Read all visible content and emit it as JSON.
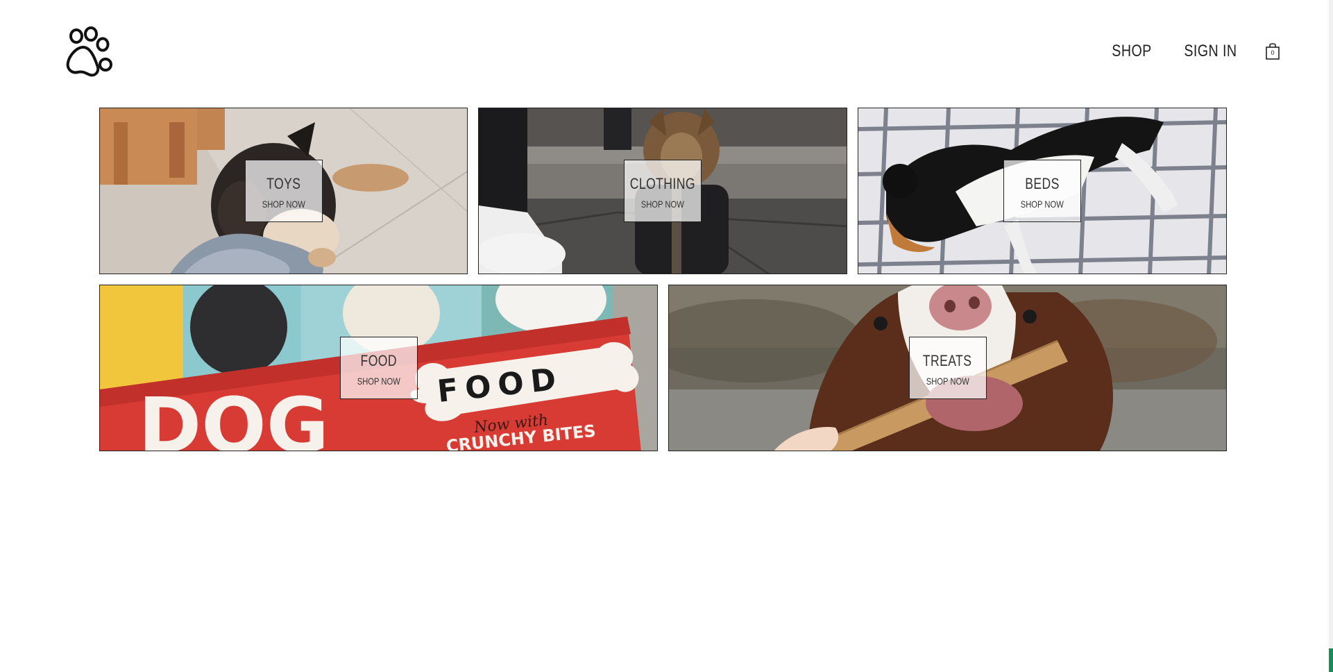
{
  "header": {
    "logo_icon": "paw-print-icon",
    "nav": [
      {
        "label": "SHOP"
      },
      {
        "label": "SIGN IN"
      }
    ],
    "cart": {
      "icon": "shopping-bag-icon",
      "count": "0"
    }
  },
  "categories": [
    {
      "title": "TOYS",
      "cta": "SHOP NOW"
    },
    {
      "title": "CLOTHING",
      "cta": "SHOP NOW"
    },
    {
      "title": "BEDS",
      "cta": "SHOP NOW"
    },
    {
      "title": "FOOD",
      "cta": "SHOP NOW"
    },
    {
      "title": "TREATS",
      "cta": "SHOP NOW"
    }
  ],
  "food_tile_package_text": [
    "DOG",
    "FOOD",
    "Now with",
    "CRUNCHY BITES"
  ],
  "colors": {
    "border": "#222222",
    "scroll_accent": "#1a8a5a"
  }
}
